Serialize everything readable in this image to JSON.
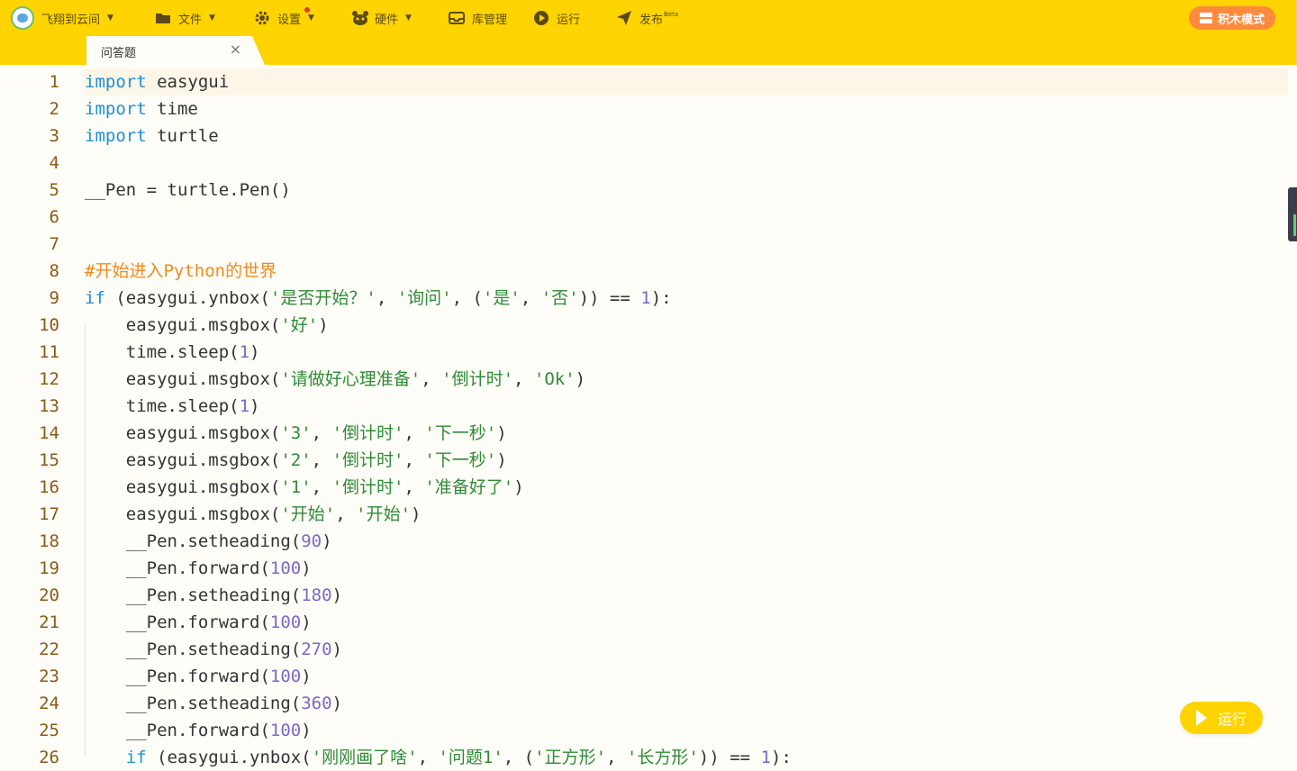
{
  "menu": {
    "project": "飞翔到云间",
    "file": "文件",
    "settings": "设置",
    "hardware": "硬件",
    "library": "库管理",
    "run": "运行",
    "publish": "发布",
    "publish_badge": "Beta",
    "mode_button": "积木模式"
  },
  "tab": {
    "label": "问答题",
    "close": "×"
  },
  "line_numbers": [
    "1",
    "2",
    "3",
    "4",
    "5",
    "6",
    "7",
    "8",
    "9",
    "10",
    "11",
    "12",
    "13",
    "14",
    "15",
    "16",
    "17",
    "18",
    "19",
    "20",
    "21",
    "22",
    "23",
    "24",
    "25",
    "26"
  ],
  "code_lines": [
    [
      [
        "kw",
        "import"
      ],
      [
        "tx",
        " easygui"
      ]
    ],
    [
      [
        "kw",
        "import"
      ],
      [
        "tx",
        " time"
      ]
    ],
    [
      [
        "kw",
        "import"
      ],
      [
        "tx",
        " turtle"
      ]
    ],
    [],
    [
      [
        "tx",
        "__Pen = turtle.Pen()"
      ]
    ],
    [],
    [],
    [
      [
        "com",
        "#开始进入Python的世界"
      ]
    ],
    [
      [
        "kw",
        "if"
      ],
      [
        "tx",
        " (easygui.ynbox("
      ],
      [
        "str",
        "'是否开始？'"
      ],
      [
        "tx",
        ", "
      ],
      [
        "str",
        "'询问'"
      ],
      [
        "tx",
        ", ("
      ],
      [
        "str",
        "'是'"
      ],
      [
        "tx",
        ", "
      ],
      [
        "str",
        "'否'"
      ],
      [
        "tx",
        ")) == "
      ],
      [
        "num",
        "1"
      ],
      [
        "tx",
        "):"
      ]
    ],
    [
      [
        "tx",
        "    easygui.msgbox("
      ],
      [
        "str",
        "'好'"
      ],
      [
        "tx",
        ")"
      ]
    ],
    [
      [
        "tx",
        "    time.sleep("
      ],
      [
        "num",
        "1"
      ],
      [
        "tx",
        ")"
      ]
    ],
    [
      [
        "tx",
        "    easygui.msgbox("
      ],
      [
        "str",
        "'请做好心理准备'"
      ],
      [
        "tx",
        ", "
      ],
      [
        "str",
        "'倒计时'"
      ],
      [
        "tx",
        ", "
      ],
      [
        "str",
        "'Ok'"
      ],
      [
        "tx",
        ")"
      ]
    ],
    [
      [
        "tx",
        "    time.sleep("
      ],
      [
        "num",
        "1"
      ],
      [
        "tx",
        ")"
      ]
    ],
    [
      [
        "tx",
        "    easygui.msgbox("
      ],
      [
        "str",
        "'3'"
      ],
      [
        "tx",
        ", "
      ],
      [
        "str",
        "'倒计时'"
      ],
      [
        "tx",
        ", "
      ],
      [
        "str",
        "'下一秒'"
      ],
      [
        "tx",
        ")"
      ]
    ],
    [
      [
        "tx",
        "    easygui.msgbox("
      ],
      [
        "str",
        "'2'"
      ],
      [
        "tx",
        ", "
      ],
      [
        "str",
        "'倒计时'"
      ],
      [
        "tx",
        ", "
      ],
      [
        "str",
        "'下一秒'"
      ],
      [
        "tx",
        ")"
      ]
    ],
    [
      [
        "tx",
        "    easygui.msgbox("
      ],
      [
        "str",
        "'1'"
      ],
      [
        "tx",
        ", "
      ],
      [
        "str",
        "'倒计时'"
      ],
      [
        "tx",
        ", "
      ],
      [
        "str",
        "'准备好了'"
      ],
      [
        "tx",
        ")"
      ]
    ],
    [
      [
        "tx",
        "    easygui.msgbox("
      ],
      [
        "str",
        "'开始'"
      ],
      [
        "tx",
        ", "
      ],
      [
        "str",
        "'开始'"
      ],
      [
        "tx",
        ")"
      ]
    ],
    [
      [
        "tx",
        "    __Pen.setheading("
      ],
      [
        "num",
        "90"
      ],
      [
        "tx",
        ")"
      ]
    ],
    [
      [
        "tx",
        "    __Pen.forward("
      ],
      [
        "num",
        "100"
      ],
      [
        "tx",
        ")"
      ]
    ],
    [
      [
        "tx",
        "    __Pen.setheading("
      ],
      [
        "num",
        "180"
      ],
      [
        "tx",
        ")"
      ]
    ],
    [
      [
        "tx",
        "    __Pen.forward("
      ],
      [
        "num",
        "100"
      ],
      [
        "tx",
        ")"
      ]
    ],
    [
      [
        "tx",
        "    __Pen.setheading("
      ],
      [
        "num",
        "270"
      ],
      [
        "tx",
        ")"
      ]
    ],
    [
      [
        "tx",
        "    __Pen.forward("
      ],
      [
        "num",
        "100"
      ],
      [
        "tx",
        ")"
      ]
    ],
    [
      [
        "tx",
        "    __Pen.setheading("
      ],
      [
        "num",
        "360"
      ],
      [
        "tx",
        ")"
      ]
    ],
    [
      [
        "tx",
        "    __Pen.forward("
      ],
      [
        "num",
        "100"
      ],
      [
        "tx",
        ")"
      ]
    ],
    [
      [
        "tx",
        "    "
      ],
      [
        "kw",
        "if"
      ],
      [
        "tx",
        " (easygui.ynbox("
      ],
      [
        "str",
        "'刚刚画了啥'"
      ],
      [
        "tx",
        ", "
      ],
      [
        "str",
        "'问题1'"
      ],
      [
        "tx",
        ", ("
      ],
      [
        "str",
        "'正方形'"
      ],
      [
        "tx",
        ", "
      ],
      [
        "str",
        "'长方形'"
      ],
      [
        "tx",
        ")) == "
      ],
      [
        "num",
        "1"
      ],
      [
        "tx",
        "):"
      ]
    ]
  ],
  "run_button": "运行",
  "colors": {
    "accent": "#ffd400",
    "mode_button": "#ff8a3d",
    "keyword": "#1e90d6",
    "string": "#2e8b37",
    "number": "#7b68c8",
    "comment": "#f08a1e",
    "line_number": "#8a5a16"
  }
}
